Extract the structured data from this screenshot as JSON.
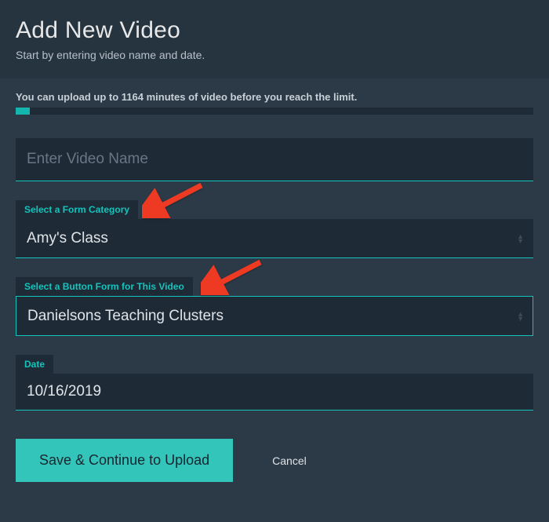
{
  "header": {
    "title": "Add New Video",
    "subtitle": "Start by entering video name and date."
  },
  "limit": {
    "text": "You can upload up to 1164 minutes of video before you reach the limit."
  },
  "video_name": {
    "placeholder": "Enter Video Name",
    "value": ""
  },
  "form_category": {
    "label": "Select a Form Category",
    "value": "Amy's Class"
  },
  "button_form": {
    "label": "Select a Button Form for This Video",
    "value": "Danielsons Teaching Clusters"
  },
  "date": {
    "label": "Date",
    "value": "10/16/2019"
  },
  "actions": {
    "save": "Save & Continue to Upload",
    "cancel": "Cancel"
  }
}
